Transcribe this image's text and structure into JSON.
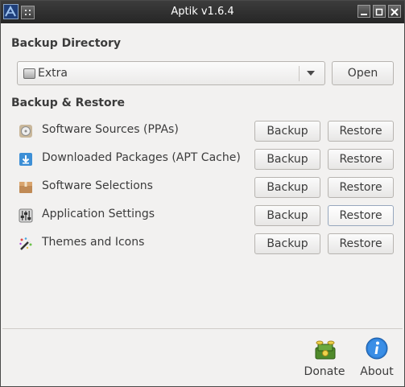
{
  "window": {
    "title": "Aptik v1.6.4"
  },
  "backup_directory": {
    "heading": "Backup Directory",
    "selected": "Extra",
    "selected_icon": "drive-icon",
    "open_label": "Open"
  },
  "backup_restore": {
    "heading": "Backup & Restore",
    "backup_label": "Backup",
    "restore_label": "Restore",
    "items": [
      {
        "label": "Software Sources (PPAs)",
        "icon": "software-sources-icon"
      },
      {
        "label": "Downloaded Packages (APT Cache)",
        "icon": "download-icon"
      },
      {
        "label": "Software Selections",
        "icon": "package-box-icon"
      },
      {
        "label": "Application Settings",
        "icon": "settings-sliders-icon"
      },
      {
        "label": "Themes and Icons",
        "icon": "themes-wand-icon"
      }
    ]
  },
  "footer": {
    "donate_label": "Donate",
    "donate_icon": "money-icon",
    "about_label": "About",
    "about_icon": "info-icon"
  },
  "colors": {
    "titlebar": "#2e2e2e",
    "window_bg": "#f2f1f0",
    "text": "#3c3c3c"
  }
}
